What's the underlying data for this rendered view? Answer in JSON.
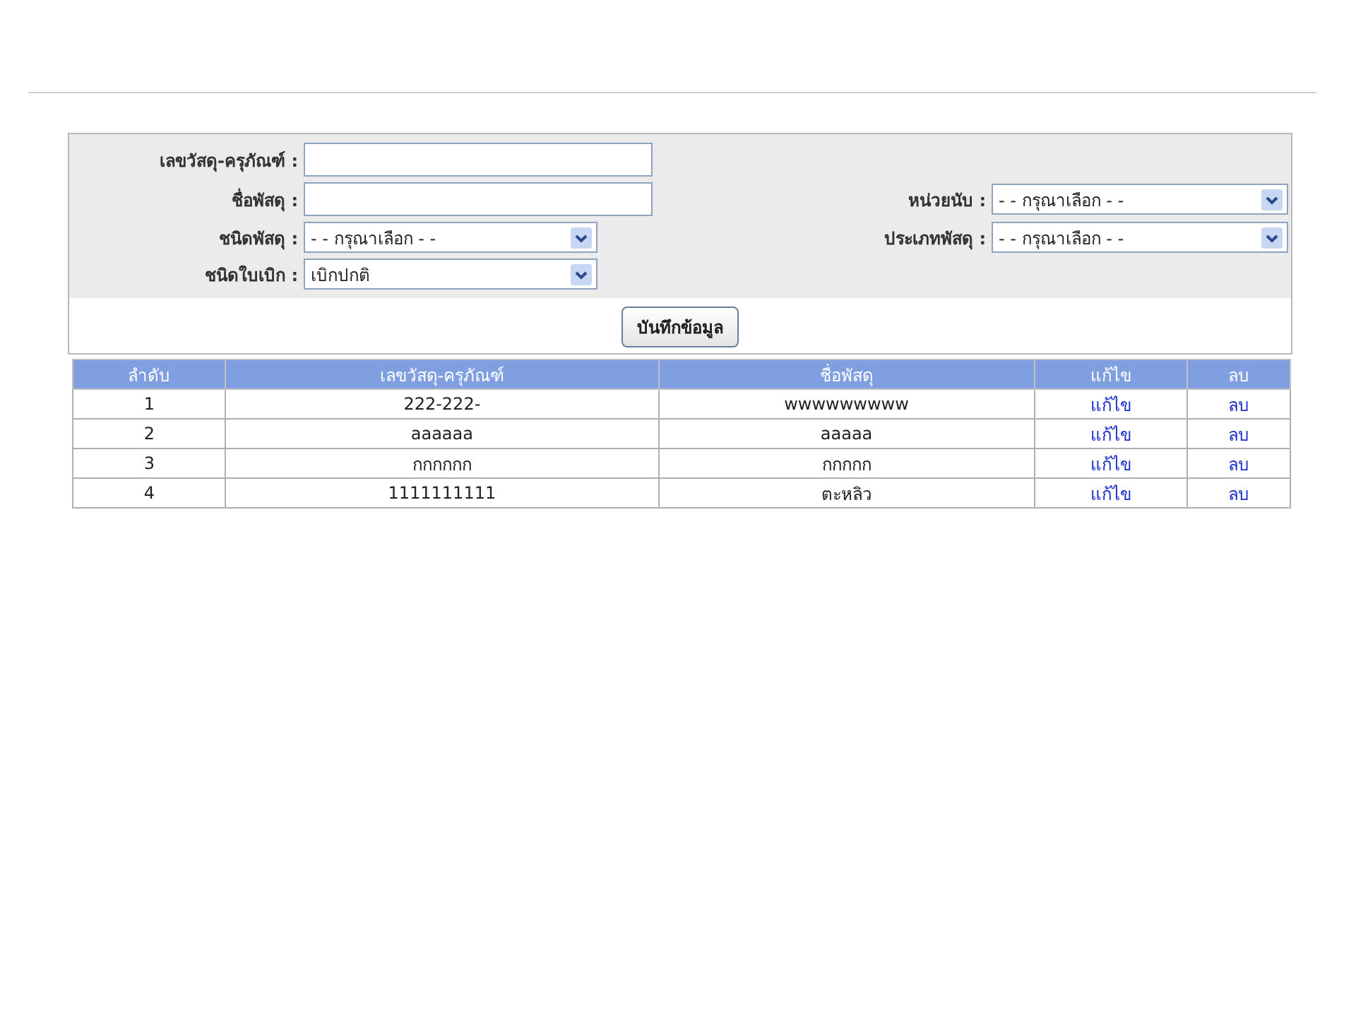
{
  "form": {
    "rows": [
      {
        "left": {
          "kind": "text",
          "label": "เลขวัสดุ-ครุภัณฑ์ :"
        }
      },
      {
        "left": {
          "kind": "text",
          "label": "ชื่อพัสดุ :"
        },
        "right": {
          "kind": "select",
          "label": "หน่วยนับ :",
          "value": "- - กรุณาเลือก - -"
        }
      },
      {
        "left": {
          "kind": "select",
          "label": "ชนิดพัสดุ :",
          "value": "- - กรุณาเลือก - -"
        },
        "right": {
          "kind": "select",
          "label": "ประเภทพัสดุ :",
          "value": "- - กรุณาเลือก - -"
        }
      },
      {
        "left": {
          "kind": "select",
          "label": "ชนิดใบเบิก :",
          "value": "เบิกปกติ"
        }
      }
    ],
    "submit": "บันทึกข้อมูล"
  },
  "table": {
    "columns": [
      "ลำดับ",
      "เลขวัสดุ-ครุภัณฑ์",
      "ชื่อพัสดุ",
      "แก้ไข",
      "ลบ"
    ],
    "rows": [
      {
        "no": "1",
        "code": "222-222-",
        "name": "wwwwwwwww",
        "edit": "แก้ไข",
        "delete": "ลบ"
      },
      {
        "no": "2",
        "code": "aaaaaa",
        "name": "aaaaa",
        "edit": "แก้ไข",
        "delete": "ลบ"
      },
      {
        "no": "3",
        "code": "กกกกกก",
        "name": "กกกกก",
        "edit": "แก้ไข",
        "delete": "ลบ"
      },
      {
        "no": "4",
        "code": "1111111111",
        "name": "ตะหลิว",
        "edit": "แก้ไข",
        "delete": "ลบ"
      }
    ]
  }
}
